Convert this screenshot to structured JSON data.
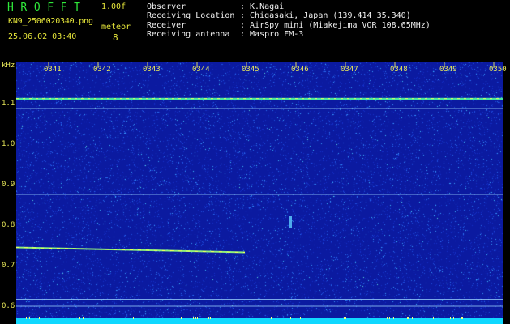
{
  "header": {
    "logo": "HROFFT",
    "version": "1.00f",
    "filename": "KN9_2506020340.png",
    "meteor_label": "meteor",
    "timestamp": "25.06.02 03:40",
    "meteor_count": "8",
    "meta": [
      {
        "label": "Observer",
        "value": ": K.Nagai"
      },
      {
        "label": "Receiving Location",
        "value": ": Chigasaki, Japan (139.414 35.340)"
      },
      {
        "label": "Receiver",
        "value": ": AirSpy mini (Miakejima VOR 108.65MHz)"
      },
      {
        "label": "Receiving antenna",
        "value": ": Maspro FM-3"
      }
    ]
  },
  "chart_data": {
    "type": "heatmap",
    "ylabel": "kHz",
    "yticks": [
      "1.1",
      "1.0",
      "0.9",
      "0.8",
      "0.7",
      "0.6"
    ],
    "ylim": [
      0.58,
      1.16
    ],
    "xticks": [
      "0341",
      "0342",
      "0343",
      "0344",
      "0345",
      "0346",
      "0347",
      "0348",
      "0349",
      "0350"
    ],
    "carrier_lines_khz": [
      1.112,
      1.088,
      0.876,
      0.783,
      0.617,
      0.6
    ],
    "meteor_echo": {
      "from_minute": "0340",
      "to_minute": "0345",
      "khz": 0.745
    },
    "colors": {
      "background": "#0b1aa0",
      "noise": "#3aa0ff",
      "strong": "#f7ff5a",
      "bottom_band": "#10d8ff"
    }
  }
}
